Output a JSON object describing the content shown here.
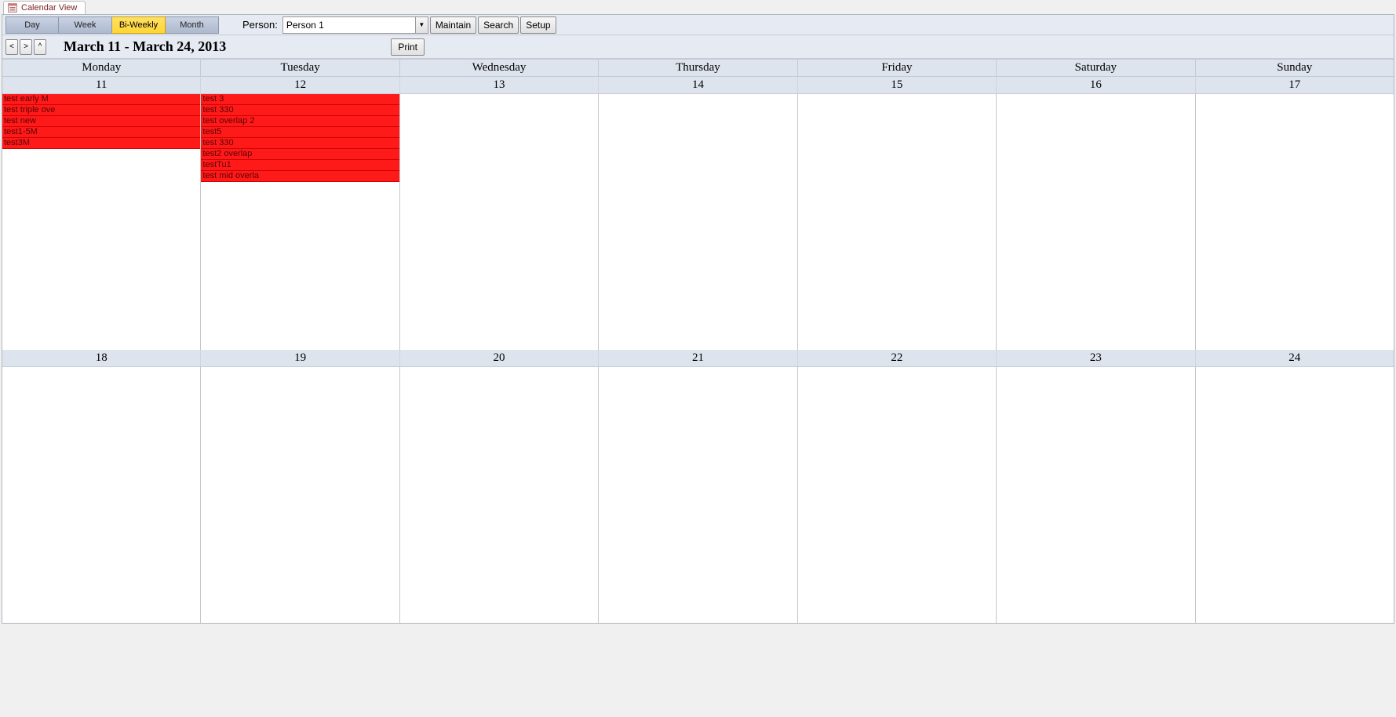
{
  "tab": {
    "title": "Calendar View"
  },
  "viewTabs": [
    {
      "label": "Day",
      "active": false
    },
    {
      "label": "Week",
      "active": false
    },
    {
      "label": "Bi-Weekly",
      "active": true
    },
    {
      "label": "Month",
      "active": false
    }
  ],
  "toolbar": {
    "personLabel": "Person:",
    "personValue": "Person 1",
    "maintain": "Maintain",
    "search": "Search",
    "setup": "Setup"
  },
  "nav": {
    "prev": "<",
    "next": ">",
    "up": "^",
    "dateRange": "March 11 - March 24, 2013",
    "print": "Print"
  },
  "dayNames": [
    "Monday",
    "Tuesday",
    "Wednesday",
    "Thursday",
    "Friday",
    "Saturday",
    "Sunday"
  ],
  "week1Dates": [
    "11",
    "12",
    "13",
    "14",
    "15",
    "16",
    "17"
  ],
  "week2Dates": [
    "18",
    "19",
    "20",
    "21",
    "22",
    "23",
    "24"
  ],
  "week1Events": [
    [
      "test early M",
      "test triple ove",
      "test new",
      "test1-5M",
      "test3M"
    ],
    [
      "test 3",
      "test 330",
      "test overlap 2",
      "test5",
      "test 330",
      "test2 overlap",
      "testTu1",
      "test mid overla"
    ],
    [],
    [],
    [],
    [],
    []
  ],
  "week2Events": [
    [],
    [],
    [],
    [],
    [],
    [],
    []
  ]
}
